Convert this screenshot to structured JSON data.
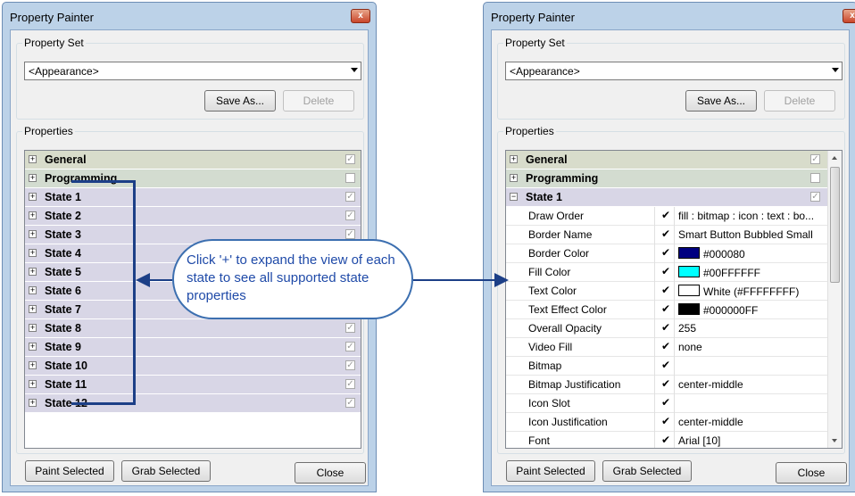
{
  "left_window": {
    "title": "Property Painter",
    "close_glyph": "x",
    "property_set_label": "Property Set",
    "property_set_value": "<Appearance>",
    "save_as_label": "Save As...",
    "delete_label": "Delete",
    "properties_label": "Properties",
    "rows": [
      {
        "label": "General",
        "checked": true
      },
      {
        "label": "Programming",
        "checked": false
      },
      {
        "label": "State 1",
        "checked": true
      },
      {
        "label": "State 2",
        "checked": true
      },
      {
        "label": "State 3",
        "checked": true
      },
      {
        "label": "State 4",
        "checked": true
      },
      {
        "label": "State 5",
        "checked": true
      },
      {
        "label": "State 6",
        "checked": true
      },
      {
        "label": "State 7",
        "checked": true
      },
      {
        "label": "State 8",
        "checked": true
      },
      {
        "label": "State 9",
        "checked": true
      },
      {
        "label": "State 10",
        "checked": true
      },
      {
        "label": "State 11",
        "checked": true
      },
      {
        "label": "State 12",
        "checked": true
      }
    ],
    "paint_selected_label": "Paint Selected",
    "grab_selected_label": "Grab Selected",
    "close_label": "Close"
  },
  "right_window": {
    "title": "Property Painter",
    "close_glyph": "x",
    "property_set_label": "Property Set",
    "property_set_value": "<Appearance>",
    "save_as_label": "Save As...",
    "delete_label": "Delete",
    "properties_label": "Properties",
    "categories": [
      {
        "label": "General",
        "checked": true,
        "expanded": false
      },
      {
        "label": "Programming",
        "checked": false,
        "expanded": false
      },
      {
        "label": "State 1",
        "checked": true,
        "expanded": true
      }
    ],
    "state_properties": [
      {
        "name": "Draw Order",
        "value": "fill : bitmap : icon : text : bo...",
        "swatch": null
      },
      {
        "name": "Border Name",
        "value": "Smart Button Bubbled Small",
        "swatch": null
      },
      {
        "name": "Border Color",
        "value": "#000080",
        "swatch": "#000080"
      },
      {
        "name": "Fill Color",
        "value": "#00FFFFFF",
        "swatch": "#00FFFF"
      },
      {
        "name": "Text Color",
        "value": "White (#FFFFFFFF)",
        "swatch": "#FFFFFF"
      },
      {
        "name": "Text Effect Color",
        "value": "#000000FF",
        "swatch": "#000000"
      },
      {
        "name": "Overall Opacity",
        "value": "255",
        "swatch": null
      },
      {
        "name": "Video Fill",
        "value": "none",
        "swatch": null
      },
      {
        "name": "Bitmap",
        "value": "",
        "swatch": null
      },
      {
        "name": "Bitmap Justification",
        "value": "center-middle",
        "swatch": null
      },
      {
        "name": "Icon Slot",
        "value": "",
        "swatch": null
      },
      {
        "name": "Icon Justification",
        "value": "center-middle",
        "swatch": null
      },
      {
        "name": "Font",
        "value": "Arial [10]",
        "swatch": null
      }
    ],
    "paint_selected_label": "Paint Selected",
    "grab_selected_label": "Grab Selected",
    "close_label": "Close"
  },
  "callout": {
    "text": "Click '+' to expand the view of each state to see all supported state properties"
  },
  "colors": {
    "accent": "#1c3f87",
    "callout_text": "#1f4aa8"
  }
}
